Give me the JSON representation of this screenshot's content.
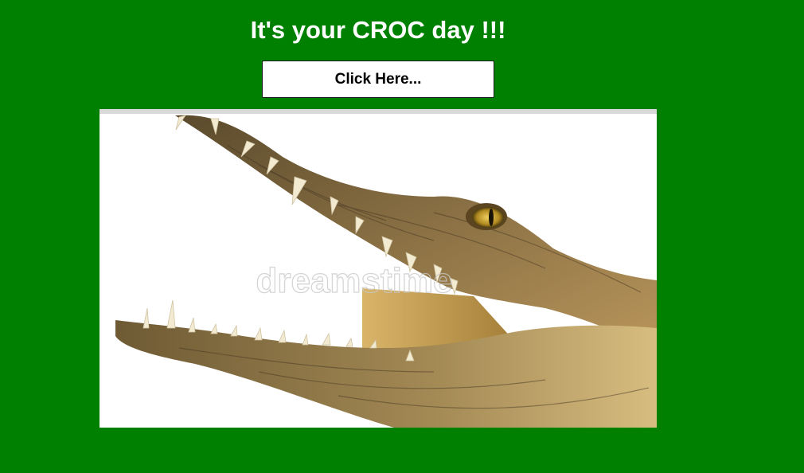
{
  "page": {
    "heading": "It's your CROC day !!!",
    "button_label": "Click Here...",
    "background_color": "#008000"
  },
  "image": {
    "subject": "crocodile-head-open-jaws",
    "watermark_text": "dreamstime"
  }
}
